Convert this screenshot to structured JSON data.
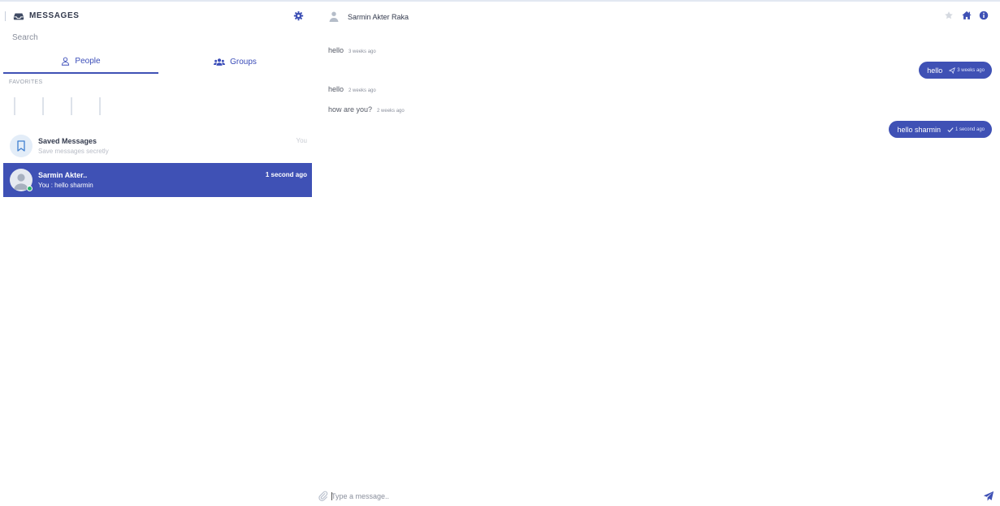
{
  "sidebar": {
    "title": "MESSAGES",
    "search_placeholder": "Search",
    "tabs": [
      {
        "label": "People",
        "icon": "person-icon",
        "active": true
      },
      {
        "label": "Groups",
        "icon": "users-icon",
        "active": false
      }
    ],
    "favorites_label": "FAVORITES",
    "contacts": [
      {
        "name": "Saved Messages",
        "subtitle": "Save messages secretly",
        "meta": "You",
        "icon": "bookmark-icon"
      },
      {
        "name": "Sarmin Akter..",
        "subtitle": "You : hello sharmin",
        "meta": "1 second ago",
        "online": true,
        "active": true
      }
    ]
  },
  "chat": {
    "contact_name": "Sarmin Akter Raka",
    "messages": [
      {
        "direction": "in",
        "text": "hello",
        "time": "3 weeks ago"
      },
      {
        "direction": "out",
        "text": "hello",
        "time": "3 weeks ago",
        "status": "sent"
      },
      {
        "direction": "in",
        "text": "hello",
        "time": "2 weeks ago"
      },
      {
        "direction": "in",
        "text": "how are you?",
        "time": "2 weeks ago"
      },
      {
        "direction": "out",
        "text": "hello sharmin",
        "time": "1 second ago",
        "status": "seen"
      }
    ],
    "input_placeholder": "Type a message.."
  },
  "colors": {
    "accent": "#3f51b5",
    "online": "#2ab36d",
    "muted_text": "#8a8f9c"
  }
}
